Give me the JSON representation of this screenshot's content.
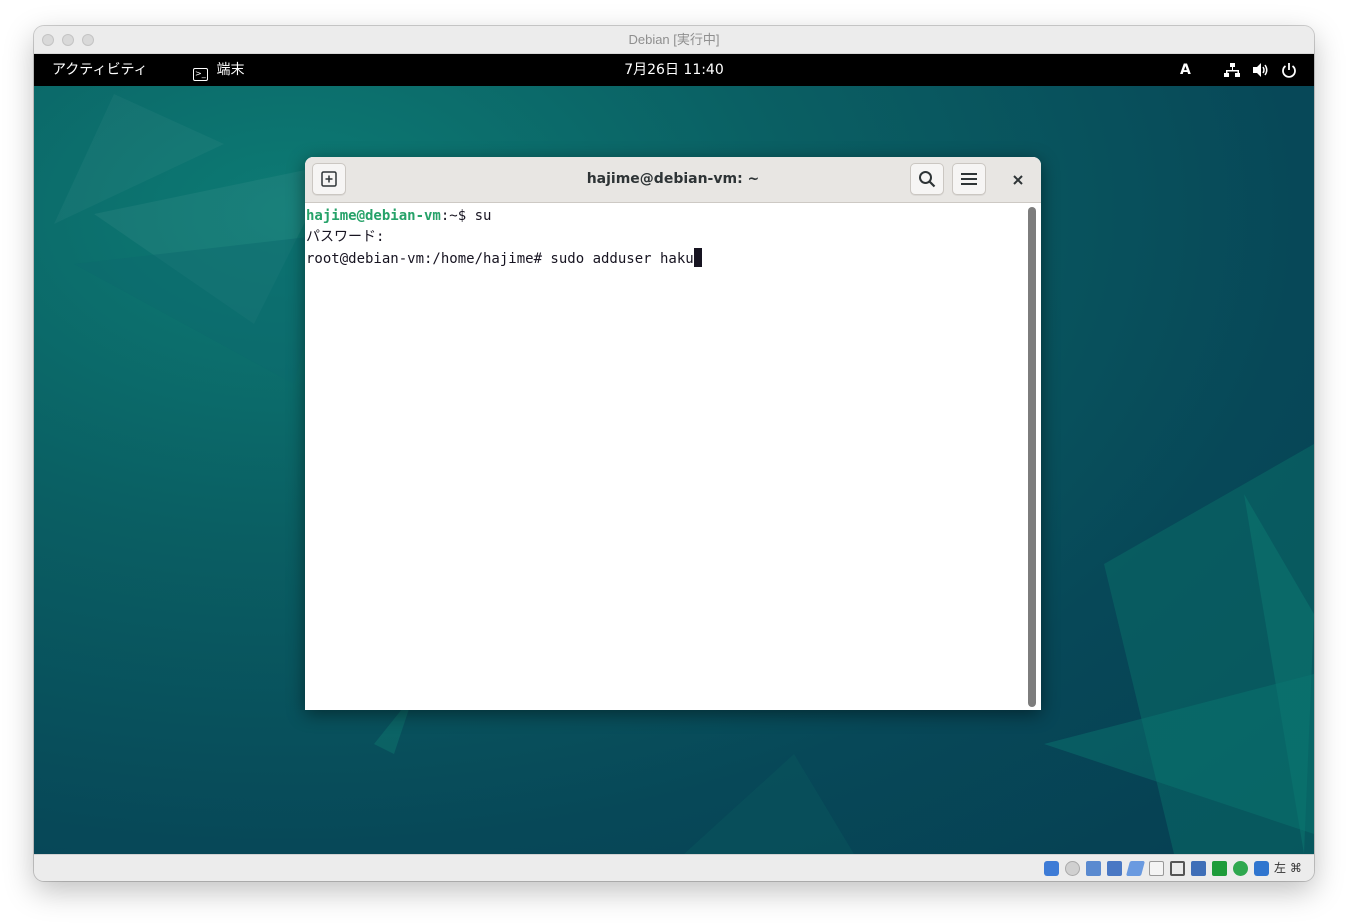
{
  "vbox": {
    "title": "Debian [実行中]",
    "host_key": "左 ⌘"
  },
  "top_panel": {
    "activities": "アクティビティ",
    "app_name": "端末",
    "clock": "7月26日 11:40",
    "input_method": "A"
  },
  "terminal": {
    "title": "hajime@debian-vm: ~",
    "lines": [
      {
        "prompt_user": "hajime@debian-vm",
        "rest": ":~$ su"
      },
      {
        "text": "パスワード:"
      },
      {
        "text": "root@debian-vm:/home/hajime# sudo adduser haku"
      }
    ]
  },
  "colors": {
    "prompt_green": "#26a269",
    "desktop_teal": "#0a5f63"
  }
}
